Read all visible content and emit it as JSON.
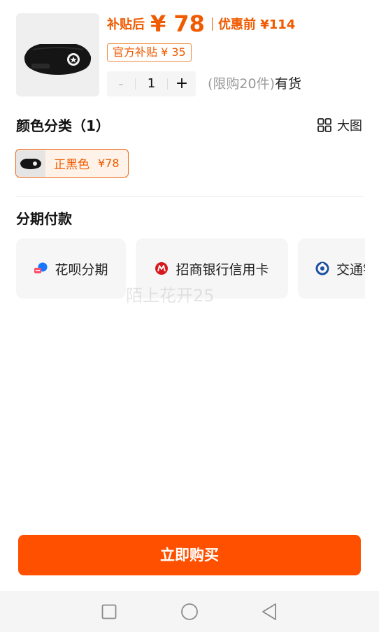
{
  "product": {
    "subsidy_label": "补贴后",
    "price_main": "¥ 78",
    "original_price": "优惠前 ¥114",
    "subsidy_badge": "官方补贴 ¥ 35",
    "thumbnail_icon": "waist-bag-icon"
  },
  "quantity": {
    "minus_label": "-",
    "value": "1",
    "plus_label": "+",
    "limit_text": "(限购20件)",
    "stock_text": "有货"
  },
  "color_section": {
    "title": "颜色分类（1）",
    "big_view_label": "大图",
    "variant": {
      "name": "正黑色",
      "price": "¥78"
    }
  },
  "installment": {
    "title": "分期付款",
    "options": [
      {
        "label": "花呗分期",
        "icon": "huabei-icon"
      },
      {
        "label": "招商银行信用卡",
        "icon": "cmb-bank-icon"
      },
      {
        "label": "交通银行信用卡",
        "icon": "bocom-bank-icon"
      }
    ]
  },
  "watermark": "陌上花开25",
  "buy_button": "立即购买",
  "colors": {
    "accent": "#ff5000",
    "price": "#f05a00"
  },
  "nav": {
    "icons": [
      "recents-square-icon",
      "home-circle-icon",
      "back-triangle-icon"
    ]
  }
}
